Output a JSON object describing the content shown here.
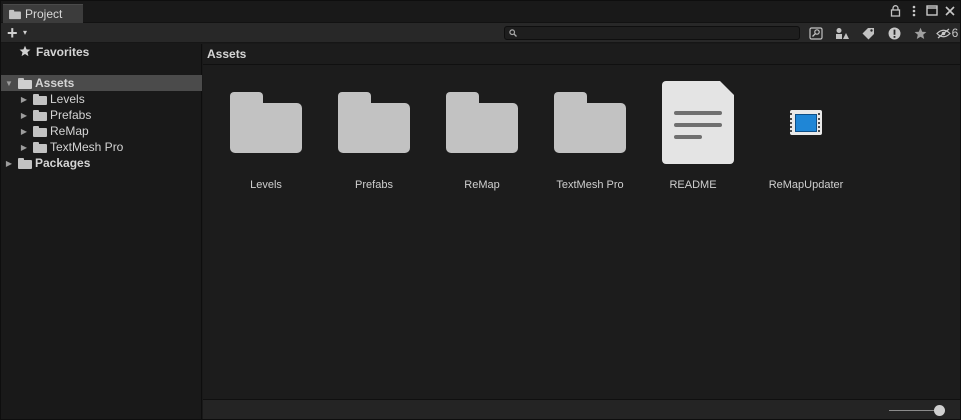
{
  "window": {
    "tab_label": "Project",
    "tab_icon": "folder-icon",
    "tab_tools": [
      "lock-icon",
      "more-icon",
      "maximize-icon",
      "close-icon"
    ]
  },
  "toolbar": {
    "create_label": "+",
    "create_caret": "▾",
    "search_placeholder": "",
    "search_value": "",
    "icons": [
      "search-by-type-icon",
      "filter-by-label-icon",
      "tag-icon",
      "warning-icon",
      "star-icon",
      "hidden-packages-icon"
    ],
    "hidden_count": "6"
  },
  "tree": {
    "favorites": {
      "label": "Favorites",
      "icon": "star-icon"
    },
    "assets": {
      "label": "Assets",
      "expanded": true,
      "selected": true
    },
    "children": [
      {
        "label": "Levels"
      },
      {
        "label": "Prefabs"
      },
      {
        "label": "ReMap"
      },
      {
        "label": "TextMesh Pro"
      }
    ],
    "packages": {
      "label": "Packages",
      "expanded": false
    }
  },
  "main": {
    "breadcrumb": "Assets",
    "items": [
      {
        "label": "Levels",
        "type": "folder"
      },
      {
        "label": "Prefabs",
        "type": "folder"
      },
      {
        "label": "ReMap",
        "type": "folder"
      },
      {
        "label": "TextMesh Pro",
        "type": "folder"
      },
      {
        "label": "README",
        "type": "document"
      },
      {
        "label": "ReMapUpdater",
        "type": "script"
      }
    ]
  },
  "footer": {
    "zoom_slider_value": 1.0
  },
  "colors": {
    "background": "#191919",
    "selected_row": "#4b4b4b",
    "script_blue": "#1f86d6",
    "folder_gray": "#c2c2c2"
  }
}
